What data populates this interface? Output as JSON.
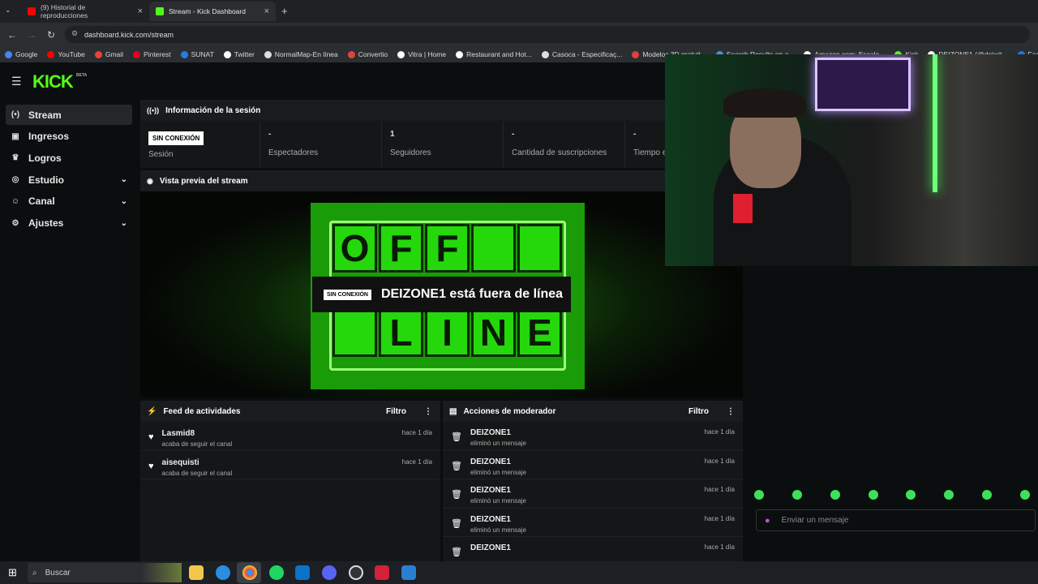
{
  "browser": {
    "tabs": [
      {
        "title": "(9) Historial de reproducciones",
        "color": "#ff0000"
      },
      {
        "title": "Stream - Kick Dashboard",
        "color": "#53fc18"
      }
    ],
    "url": "dashboard.kick.com/stream",
    "bookmarks": [
      "Google",
      "YouTube",
      "Gmail",
      "Pinterest",
      "SUNAT",
      "Twitter",
      "NormalMap-En línea",
      "Convertio",
      "Vitra | Home",
      "Restaurant and Hot...",
      "Casoca - Especificaç...",
      "Modelos 3D gratuit...",
      "Search Results on a...",
      "Amazon.com: Escale...",
      "Kick",
      "DEIZONE1 (@deiwit...",
      "Facebook"
    ]
  },
  "logo": "KICK",
  "logo_sup": "BETA",
  "sidebar": {
    "items": [
      {
        "label": "Stream",
        "icon": "broadcast-icon"
      },
      {
        "label": "Ingresos",
        "icon": "money-icon"
      },
      {
        "label": "Logros",
        "icon": "trophy-icon"
      },
      {
        "label": "Estudio",
        "icon": "studio-icon"
      },
      {
        "label": "Canal",
        "icon": "user-icon"
      },
      {
        "label": "Ajustes",
        "icon": "gear-icon"
      }
    ]
  },
  "session": {
    "title": "Información de la sesión",
    "status_badge": "SIN CONEXIÓN",
    "stats": [
      {
        "label": "Sesión"
      },
      {
        "label": "Espectadores",
        "value": "-"
      },
      {
        "label": "Seguidores",
        "value": "1"
      },
      {
        "label": "Cantidad de suscripciones",
        "value": "-"
      },
      {
        "label": "Tiempo e",
        "value": "-"
      }
    ]
  },
  "preview": {
    "title": "Vista previa del stream",
    "badge": "SIN CONEXIÓN",
    "message": "DEIZONE1 está fuera de línea",
    "top_letters": [
      "O",
      "F",
      "F",
      "",
      ""
    ],
    "bottom_letters": [
      "",
      "L",
      "I",
      "N",
      "E"
    ]
  },
  "feed": {
    "title": "Feed de actividades",
    "filter": "Filtro",
    "items": [
      {
        "name": "Lasmid8",
        "action": "acaba de seguir el canal",
        "time": "hace 1 día"
      },
      {
        "name": "aisequisti",
        "action": "acaba de seguir el canal",
        "time": "hace 1 día"
      }
    ]
  },
  "mod": {
    "title": "Acciones de moderador",
    "filter": "Filtro",
    "items": [
      {
        "name": "DEIZONE1",
        "action": "eliminó un mensaje",
        "time": "hace 1 día"
      },
      {
        "name": "DEIZONE1",
        "action": "eliminó un mensaje",
        "time": "hace 1 día"
      },
      {
        "name": "DEIZONE1",
        "action": "eliminó un mensaje",
        "time": "hace 1 día"
      },
      {
        "name": "DEIZONE1",
        "action": "eliminó un mensaje",
        "time": "hace 1 día"
      },
      {
        "name": "DEIZONE1",
        "action": "",
        "time": "hace 1 día"
      }
    ]
  },
  "chat": {
    "placeholder": "Enviar un mensaje"
  },
  "taskbar": {
    "search": "Buscar"
  }
}
